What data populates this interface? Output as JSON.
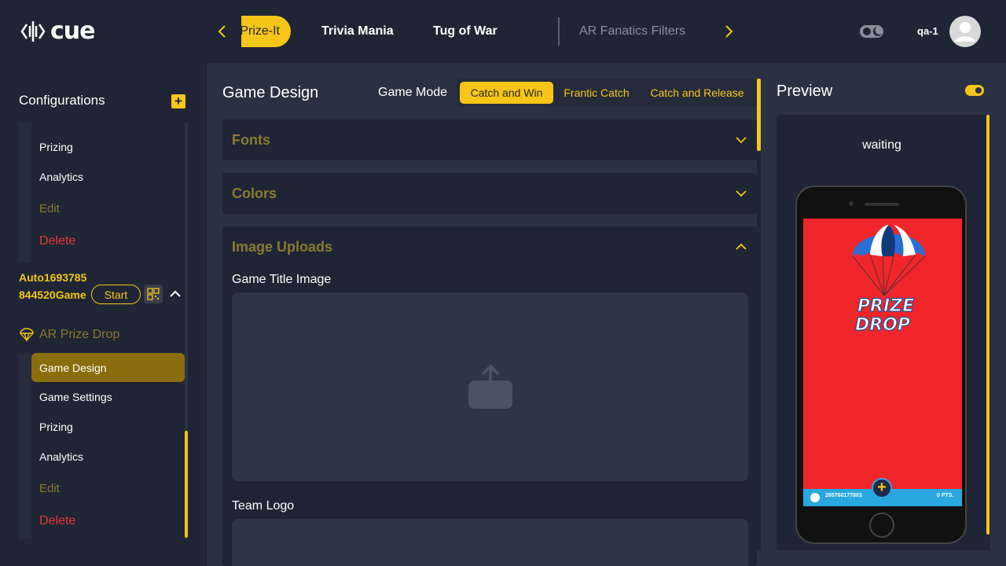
{
  "header": {
    "logo_text": "cue",
    "tabs": [
      {
        "label": "Prize-It"
      },
      {
        "label": "Trivia Mania"
      },
      {
        "label": "Tug of War"
      },
      {
        "label": "AR Fanatics Filters"
      }
    ],
    "user_name": "qa-1"
  },
  "sidebar": {
    "title": "Configurations",
    "first_game_items": [
      {
        "label": "Prizing"
      },
      {
        "label": "Analytics"
      },
      {
        "label": "Edit"
      },
      {
        "label": "Delete"
      }
    ],
    "game_name": "Auto1693785844520Game",
    "start_label": "Start",
    "game_type": "AR Prize Drop",
    "second_game_items": [
      {
        "label": "Game Design"
      },
      {
        "label": "Game Settings"
      },
      {
        "label": "Prizing"
      },
      {
        "label": "Analytics"
      },
      {
        "label": "Edit"
      },
      {
        "label": "Delete"
      }
    ]
  },
  "main": {
    "title": "Game Design",
    "game_mode_label": "Game Mode",
    "modes": [
      {
        "label": "Catch and Win",
        "active": true
      },
      {
        "label": "Frantic Catch"
      },
      {
        "label": "Catch and Release"
      }
    ],
    "sections": [
      {
        "title": "Fonts"
      },
      {
        "title": "Colors"
      },
      {
        "title": "Image Uploads"
      }
    ],
    "uploads": [
      {
        "label": "Game Title Image"
      },
      {
        "label": "Team Logo"
      }
    ]
  },
  "preview": {
    "title": "Preview",
    "status": "waiting",
    "phone": {
      "game_title_line1": "PRIZE",
      "game_title_line2": "DROP",
      "score_id": "265760177803",
      "points": "0 PTS."
    }
  },
  "colors": {
    "accent": "#f5c518",
    "background": "#1f2534",
    "panel": "#2a3142",
    "danger": "#e53935",
    "phone_screen": "#f0262b"
  }
}
